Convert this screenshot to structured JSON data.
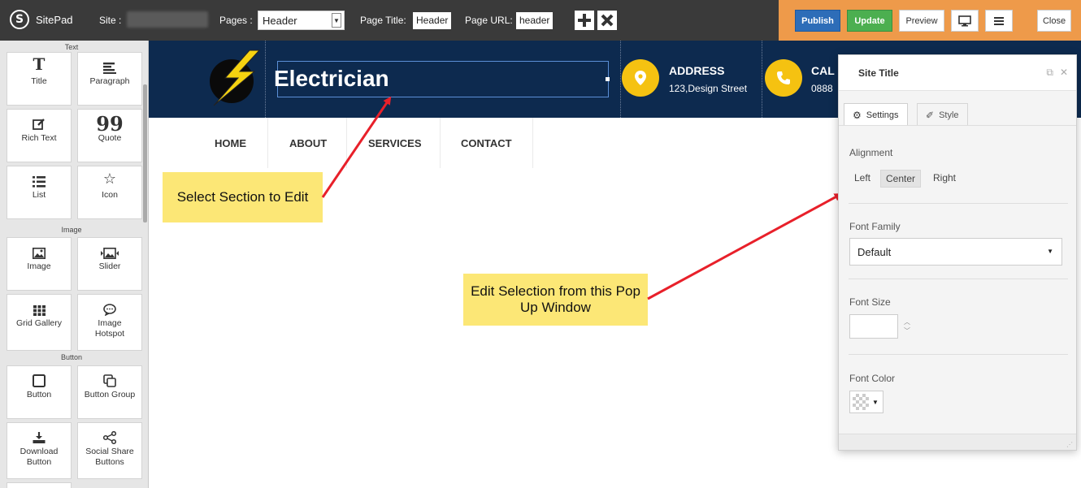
{
  "topbar": {
    "brand": "SitePad",
    "site_label": "Site :",
    "pages_label": "Pages :",
    "pages_value": "Header",
    "page_title_label": "Page Title:",
    "page_title_value": "Header",
    "page_url_label": "Page URL:",
    "page_url_value": "header",
    "publish": "Publish",
    "update": "Update",
    "preview": "Preview",
    "close": "Close"
  },
  "sidebar": {
    "sections": {
      "text": "Text",
      "image": "Image",
      "button": "Button"
    },
    "widgets": {
      "title": "Title",
      "paragraph": "Paragraph",
      "rich_text": "Rich Text",
      "quote": "Quote",
      "list": "List",
      "icon": "Icon",
      "image": "Image",
      "slider": "Slider",
      "grid_gallery": "Grid Gallery",
      "image_hotspot": "Image Hotspot",
      "button": "Button",
      "button_group": "Button Group",
      "download_button": "Download Button",
      "social_share_buttons": "Social Share Buttons"
    }
  },
  "site": {
    "title": "Electrician",
    "address_label": "ADDRESS",
    "address_value": "123,Design Street",
    "call_label": "CAL",
    "call_value": "0888",
    "nav": [
      "HOME",
      "ABOUT",
      "SERVICES",
      "CONTACT"
    ]
  },
  "callouts": {
    "select": "Select Section to Edit",
    "edit": "Edit Selection from this Pop Up Window"
  },
  "popup": {
    "title": "Site Title",
    "tab_settings": "Settings",
    "tab_style": "Style",
    "alignment_label": "Alignment",
    "align_left": "Left",
    "align_center": "Center",
    "align_right": "Right",
    "font_family_label": "Font Family",
    "font_family_value": "Default",
    "font_size_label": "Font Size",
    "font_color_label": "Font Color"
  },
  "colors": {
    "topbar": "#3a3a3a",
    "accent_orange": "#ee9a4a",
    "publish_blue": "#2d6db8",
    "update_green": "#4caf50",
    "header_navy": "#0d2a4f",
    "icon_yellow": "#f5c211",
    "callout_yellow": "#fce776",
    "arrow_red": "#e8202a"
  }
}
